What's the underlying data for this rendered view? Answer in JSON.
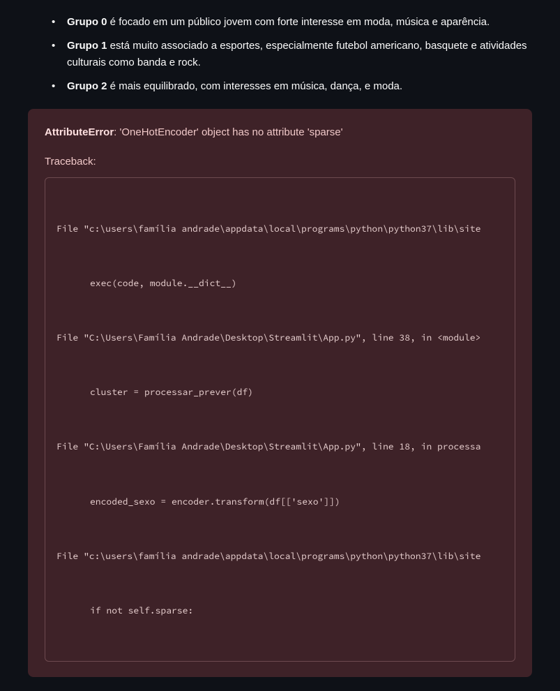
{
  "groups": [
    {
      "label": "Grupo 0",
      "text": " é focado em um público jovem com forte interesse em moda, música e aparência."
    },
    {
      "label": "Grupo 1",
      "text": " está muito associado a esportes, especialmente futebol americano, basquete e atividades culturais como banda e rock."
    },
    {
      "label": "Grupo 2",
      "text": " é mais equilibrado, com interesses em música, dança, e moda."
    }
  ],
  "error": {
    "name": "AttributeError",
    "message": ": 'OneHotEncoder' object has no attribute 'sparse'",
    "traceback_label": "Traceback:",
    "frames": [
      {
        "file": "File \"c:\\users\\família andrade\\appdata\\local\\programs\\python\\python37\\lib\\site",
        "code": "exec(code, module.__dict__)"
      },
      {
        "file": "File \"C:\\Users\\Família Andrade\\Desktop\\Streamlit\\App.py\", line 38, in <module>",
        "code": "cluster = processar_prever(df)"
      },
      {
        "file": "File \"C:\\Users\\Família Andrade\\Desktop\\Streamlit\\App.py\", line 18, in processa",
        "code": "encoded_sexo = encoder.transform(df[['sexo']])"
      },
      {
        "file": "File \"c:\\users\\família andrade\\appdata\\local\\programs\\python\\python37\\lib\\site",
        "code": "if not self.sparse:"
      }
    ]
  }
}
